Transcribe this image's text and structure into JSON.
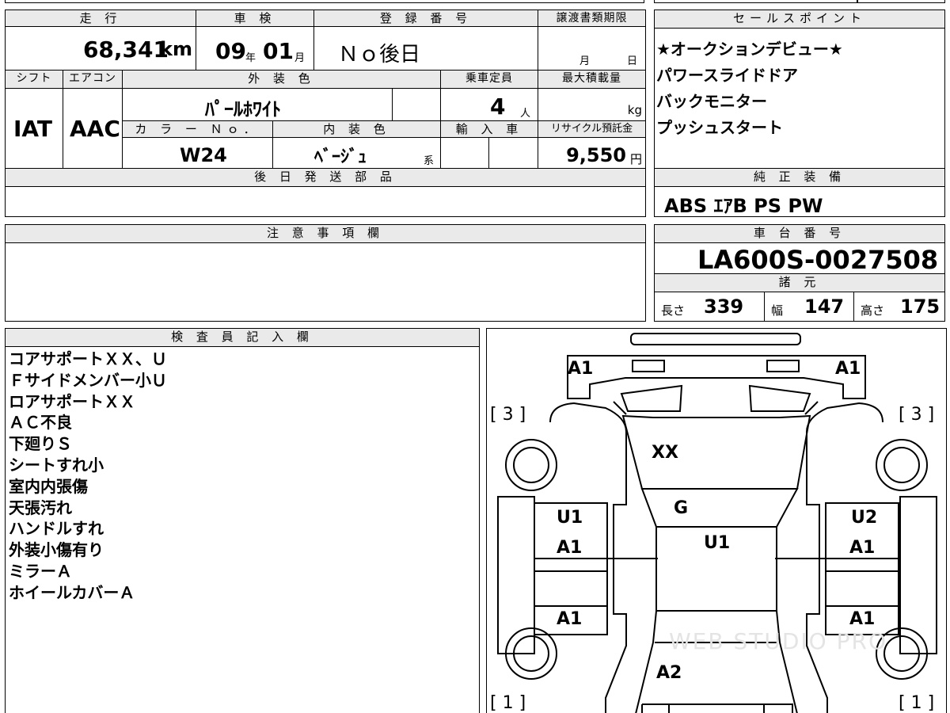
{
  "top_row": {
    "mileage_label": "走 行",
    "mileage_value": "68,341",
    "mileage_unit": "km",
    "inspection_label": "車 検",
    "inspection_year": "09",
    "year_unit": "年",
    "inspection_month": "01",
    "month_unit": "月",
    "registration_label": "登 録 番 号",
    "registration_value": "Ｎｏ後日",
    "transfer_label": "譲渡書類期限",
    "transfer_month": "月",
    "transfer_day": "日"
  },
  "mid_row": {
    "shift_label": "シフト",
    "shift_value": "IAT",
    "aircon_label": "エアコン",
    "aircon_value": "AAC",
    "exterior_label": "外 装 色",
    "exterior_value": "ﾊﾟｰﾙﾎﾜｲﾄ",
    "capacity_label": "乗車定員",
    "capacity_value": "4",
    "capacity_unit": "人",
    "max_load_label": "最大積載量",
    "max_load_unit": "kg",
    "color_no_label": "カ ラ ー Ｎｏ．",
    "color_no_value": "W24",
    "interior_label": "内 装 色",
    "interior_value": "ﾍﾞｰｼﾞｭ",
    "interior_suffix": "系",
    "import_label": "輸 入 車",
    "recycle_label": "リサイクル預託金",
    "recycle_value": "9,550",
    "recycle_unit": "円",
    "later_parts_label": "後 日 発 送 部 品"
  },
  "sales_points": {
    "label": "セールスポイント",
    "items": [
      "★オークションデビュー★",
      "パワースライドドア",
      "バックモニター",
      "プッシュスタート"
    ]
  },
  "genuine_equipment": {
    "label": "純 正 装 備",
    "value": "ABS ｴｱB PS PW"
  },
  "notes": {
    "label": "注 意 事 項 欄"
  },
  "chassis": {
    "label": "車 台 番 号",
    "value": "LA600S-0027508",
    "specs_label": "諸 元",
    "length_label": "長さ",
    "length_value": "339",
    "width_label": "幅",
    "width_value": "147",
    "height_label": "高さ",
    "height_value": "175"
  },
  "inspector": {
    "label": "検 査 員 記 入 欄",
    "lines": [
      "コアサポートＸＸ、Ｕ",
      "Ｆサイドメンバー小Ｕ",
      "ロアサポートＸＸ",
      "ＡＣ不良",
      "下廻りＳ",
      "シートすれ小",
      "室内内張傷",
      "天張汚れ",
      "ハンドルすれ",
      "外装小傷有り",
      "ミラーＡ",
      "ホイールカバーＡ"
    ]
  },
  "diagram": {
    "front_left_corner": "A1",
    "front_right_corner": "A1",
    "front_left_tire": "[ 3 ]",
    "front_right_tire": "[ 3 ]",
    "rear_left_tire": "[ 1 ]",
    "rear_right_tire": "[ 1 ]",
    "hood": "XX",
    "windshield": "G",
    "roof": "U1",
    "front_left_door_1": "U1",
    "front_left_door_2": "A1",
    "front_right_door_1": "U2",
    "front_right_door_2": "A1",
    "rear_left_door": "A1",
    "rear_right_door": "A1",
    "rear_gate": "A2",
    "watermark": "WEB STUDIO PRO"
  }
}
